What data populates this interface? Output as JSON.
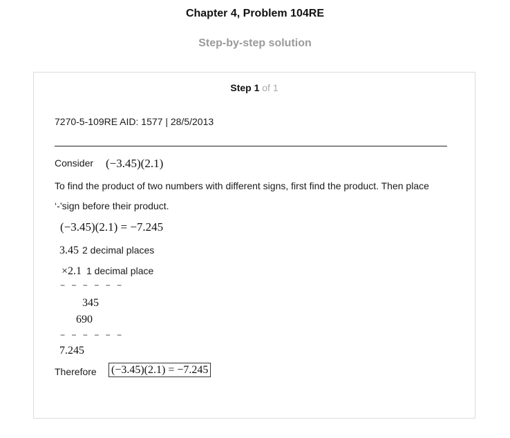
{
  "header": {
    "title": "Chapter 4, Problem 104RE",
    "subtitle": "Step-by-step solution"
  },
  "step": {
    "label": "Step 1",
    "of": "of 1"
  },
  "content": {
    "meta": "7270-5-109RE AID: 1577 | 28/5/2013",
    "consider_label": "Consider",
    "consider_expr": "(−3.45)(2.1)",
    "para_line1": "To find the product of two numbers with different signs, first find the product. Then place",
    "para_line2": "‘-’sign before their product.",
    "eq1": "(−3.45)(2.1) = −7.245",
    "mult": {
      "row1_num": "3.45",
      "row1_note": "2 decimal places",
      "row2_num": "×2.1",
      "row2_note": "1 decimal place",
      "dashes": "− − − − − −",
      "partial1": "345",
      "partial2": "690",
      "dashes2": "− − − − − −",
      "result": "7.245"
    },
    "therefore_label": "Therefore",
    "therefore_expr": "(−3.45)(2.1) = −7.245"
  }
}
